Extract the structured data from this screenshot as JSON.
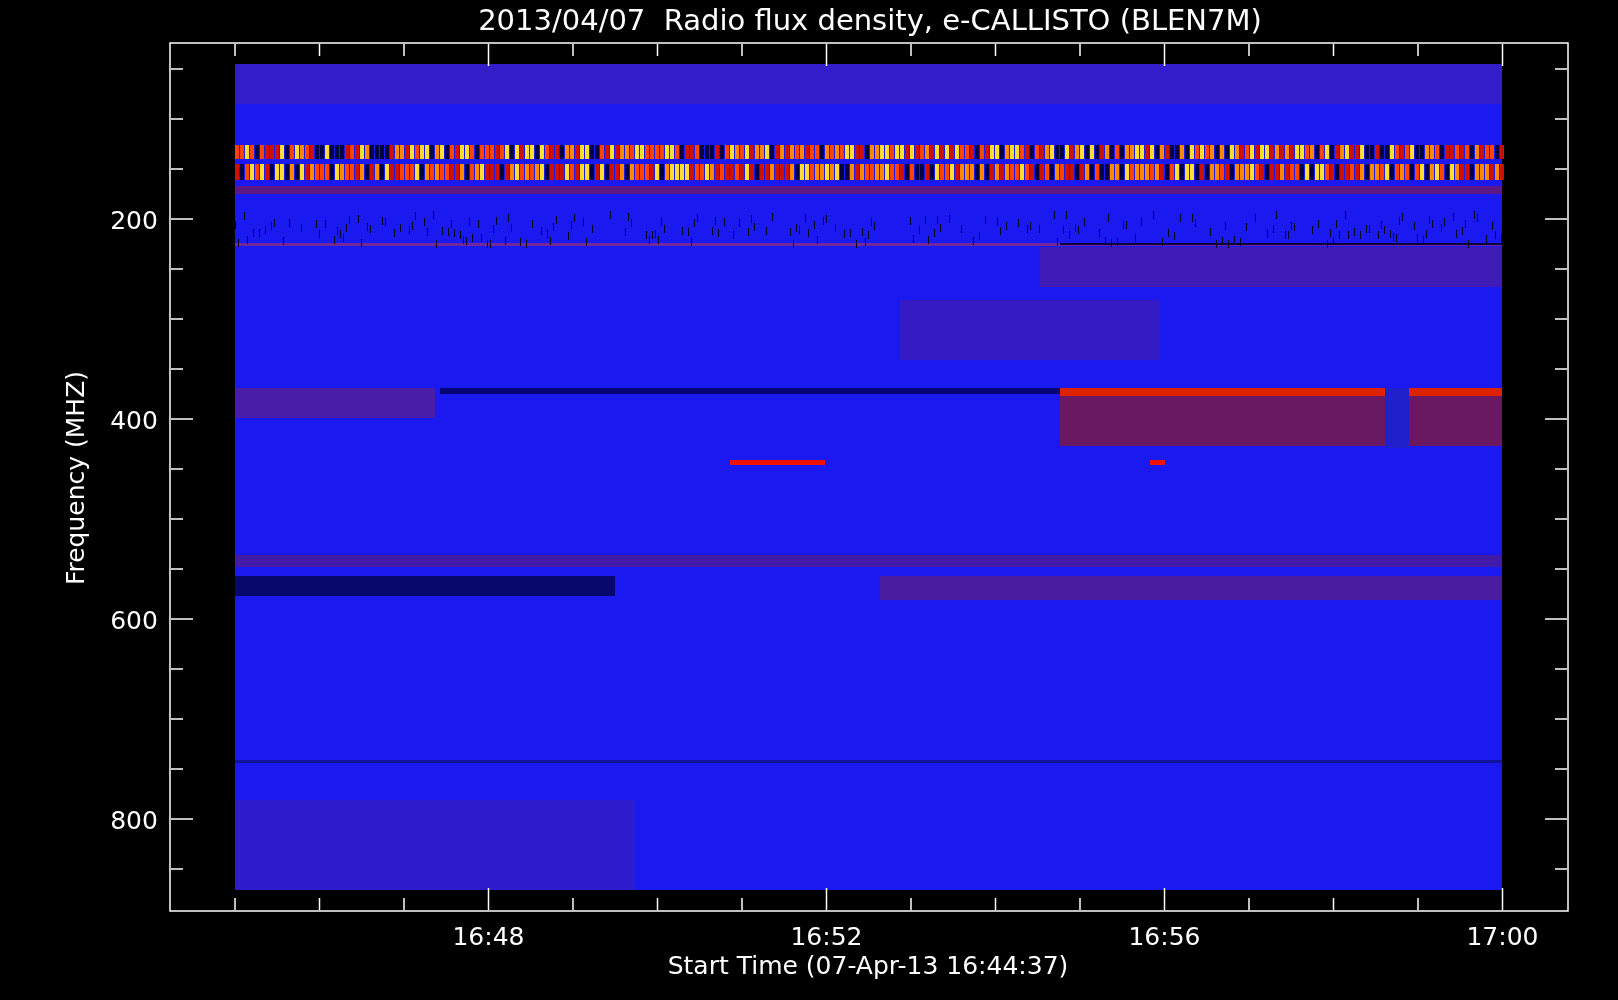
{
  "title": "2013/04/07  Radio flux density, e-CALLISTO (BLEN7M)",
  "y_axis": {
    "label": "Frequency (MHZ)",
    "ticks": [
      "200",
      "400",
      "600",
      "800"
    ]
  },
  "x_axis": {
    "label": "Start Time (07-Apr-13 16:44:37)",
    "ticks": [
      "16:48",
      "16:52",
      "16:56",
      "17:00"
    ]
  }
}
